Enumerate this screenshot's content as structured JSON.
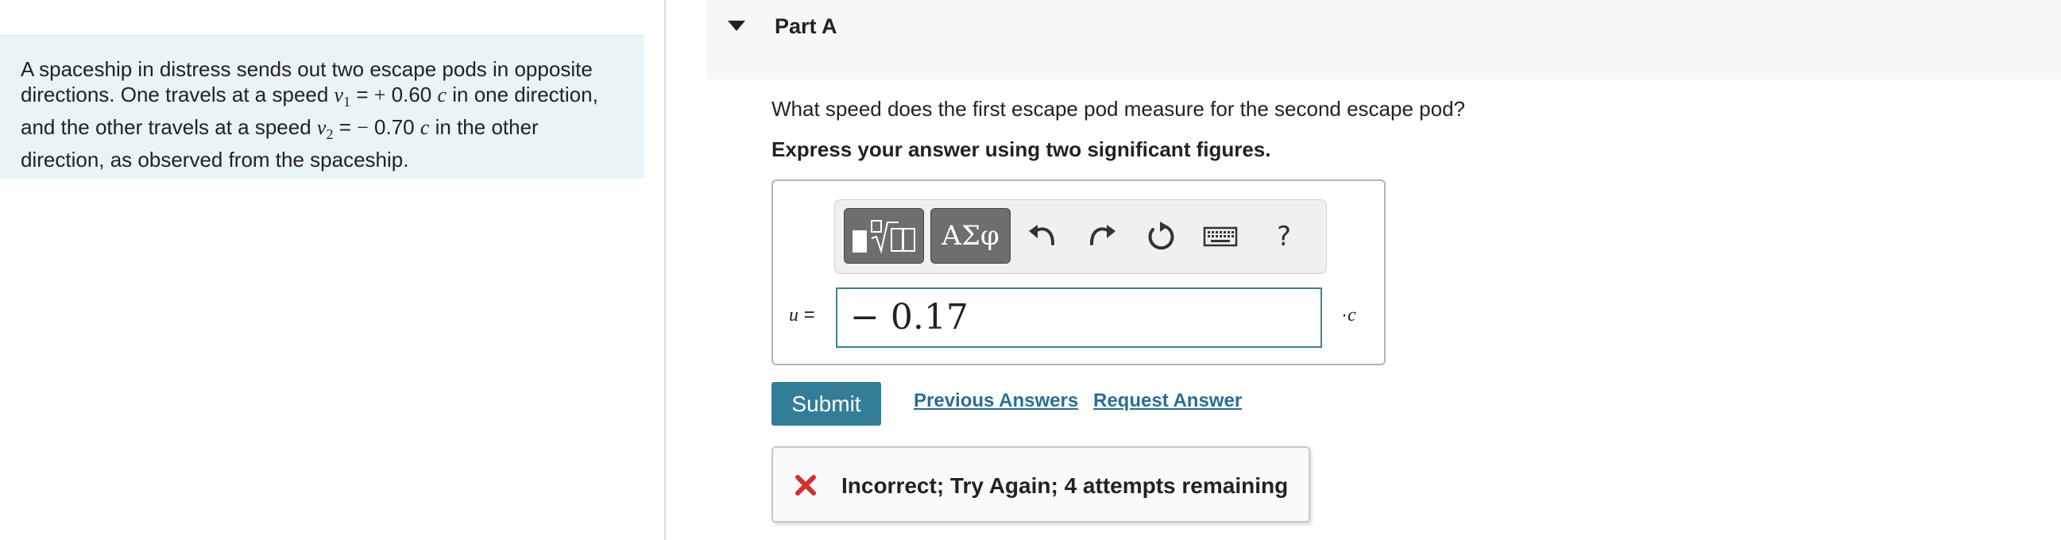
{
  "problem": {
    "text_1": "A spaceship in distress sends out two escape pods in opposite",
    "text_2": "directions. One travels at a speed ",
    "v1_var": "v",
    "v1_sub": "1",
    "v1_eq": " = ",
    "v1_sign": "+",
    "v1_value": " 0.60 ",
    "c1": "c",
    "text_3": " in one direction,",
    "text_4": "and the other travels at a speed ",
    "v2_var": "v",
    "v2_sub": "2",
    "v2_eq": " = ",
    "v2_sign": "−",
    "v2_value": " 0.70 ",
    "c2": "c",
    "text_5": " in the other",
    "text_6": "direction, as observed from the spaceship."
  },
  "part": {
    "title": "Part A",
    "question": "What speed does the first escape pod measure for the second escape pod?",
    "instruction": "Express your answer using two significant figures."
  },
  "toolbar": {
    "greek_label": "ΑΣφ",
    "help_label": "?",
    "icons": [
      "templates-icon",
      "undo-icon",
      "redo-icon",
      "reset-icon",
      "keyboard-icon",
      "help-icon"
    ]
  },
  "answer": {
    "variable": "u",
    "equals": " =",
    "value": "− 0.17",
    "unit_prefix": "·",
    "unit": "c"
  },
  "actions": {
    "submit_label": "Submit",
    "previous_answers_label": "Previous Answers",
    "request_answer_label": "Request Answer"
  },
  "feedback": {
    "message": "Incorrect; Try Again; 4 attempts remaining",
    "icon": "x-mark-icon",
    "icon_color": "#d0312d"
  },
  "colors": {
    "submit_bg": "#337d99",
    "link": "#2a6e93",
    "panel_bg": "#e8f4f6",
    "input_border": "#3f7f94"
  }
}
